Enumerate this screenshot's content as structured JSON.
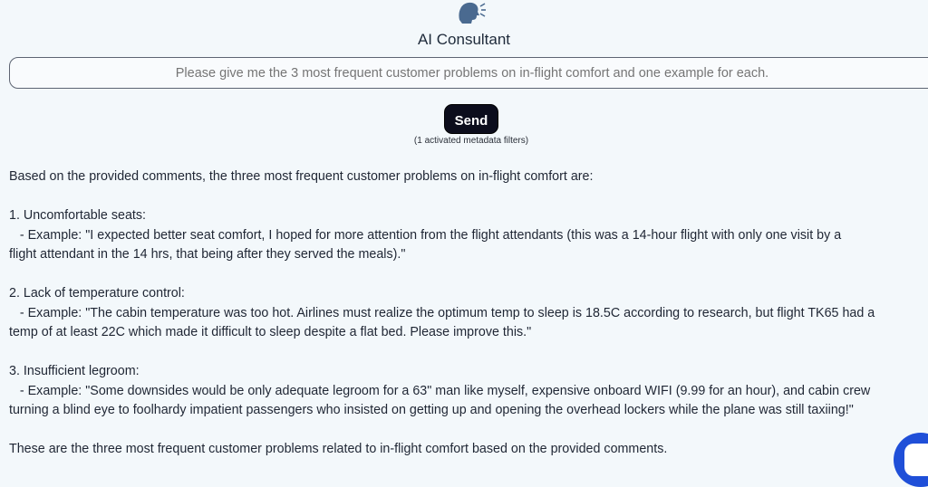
{
  "app": {
    "title": "AI Consultant",
    "logo_icon": "speaking-head-icon"
  },
  "query": {
    "placeholder": "Please give me the 3 most frequent customer problems on in-flight comfort and one example for each.",
    "value": ""
  },
  "send_label": "Send",
  "filters_note": "(1 activated metadata filters)",
  "answer": {
    "intro": "Based on the provided comments, the three most frequent customer problems on in-flight comfort are:",
    "items": [
      {
        "heading": "1. Uncomfortable seats:",
        "example_line1": "   - Example: \"I expected better seat comfort, I hoped for more attention from the flight attendants (this was a 14-hour flight with only one visit by a",
        "example_line2": "flight attendant in the 14 hrs, that being after they served the meals).\""
      },
      {
        "heading": "2. Lack of temperature control:",
        "example_line1": "   - Example: \"The cabin temperature was too hot. Airlines must realize the optimum temp to sleep is 18.5C according to research, but flight TK65 had a",
        "example_line2": "temp of at least 22C which made it difficult to sleep despite a flat bed. Please improve this.\""
      },
      {
        "heading": "3. Insufficient legroom:",
        "example_line1": "   - Example: \"Some downsides would be only adequate legroom for a 63\" man like myself, expensive onboard WIFI (9.99 for an hour), and cabin crew",
        "example_line2": "turning a blind eye to foolhardy impatient passengers who insisted on getting up and opening the overhead lockers while the plane was still taxiing!\""
      }
    ],
    "conclusion": "These are the three most frequent customer problems related to in-flight comfort based on the provided comments."
  },
  "chat_widget_icon": "chat-bubble-icon",
  "colors": {
    "background": "#f3f8fb",
    "button": "#0c0d1c",
    "chat_widget": "#1f4fd8"
  }
}
